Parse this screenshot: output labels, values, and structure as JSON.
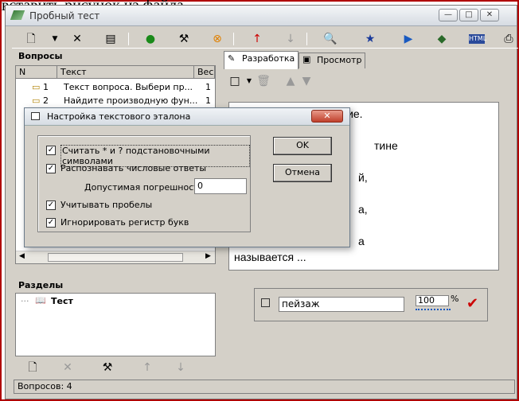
{
  "background_text": "вставить рисунок из файла",
  "window": {
    "title": "Пробный тест",
    "controls": {
      "minimize": "—",
      "maximize": "□",
      "close": "✕"
    }
  },
  "toolbar": {
    "icons": [
      "new-doc-icon",
      "dropdown-icon",
      "delete-icon",
      "properties-icon",
      "money-icon",
      "tools-icon",
      "cancel-icon",
      "up-red-icon",
      "down-gray-icon",
      "search-icon",
      "star-icon",
      "play-icon",
      "book-icon",
      "html-icon",
      "print-icon"
    ]
  },
  "questions": {
    "heading": "Вопросы",
    "columns": [
      "N",
      "Текст",
      "Вес"
    ],
    "rows": [
      {
        "n": "1",
        "text": "Текст вопроса. Выбери пр...",
        "weight": "1"
      },
      {
        "n": "2",
        "text": "Найдите производную фун...",
        "weight": "1"
      }
    ]
  },
  "sections": {
    "heading": "Разделы",
    "items": [
      "Тест"
    ]
  },
  "status": {
    "text": "Вопросов: 4"
  },
  "tabs": [
    {
      "label": "Разработка",
      "active": true
    },
    {
      "label": "Просмотр",
      "active": false
    }
  ],
  "preview": {
    "lines": [
      "Продолжи предложение.",
      "тине",
      "й,",
      "а,",
      "а",
      "называется ..."
    ]
  },
  "answer": {
    "value": "пейзаж",
    "percent": "100",
    "percent_sign": "%"
  },
  "dialog": {
    "title": "Настройка текстового эталона",
    "close_label": "✕",
    "options": [
      {
        "label": "Считать * и ? подстановочными символами",
        "checked": true
      },
      {
        "label": "Распознавать числовые ответы",
        "checked": true
      },
      {
        "label": "Учитывать пробелы",
        "checked": true
      },
      {
        "label": "Игнорировать регистр букв",
        "checked": true
      }
    ],
    "tolerance_label": "Допустимая погрешность:",
    "tolerance_value": "0",
    "ok_label": "OK",
    "cancel_label": "Отмена"
  },
  "colors": {
    "accent": "#b00000",
    "window_bg": "#d4d0c8",
    "check_red": "#cc0000"
  }
}
